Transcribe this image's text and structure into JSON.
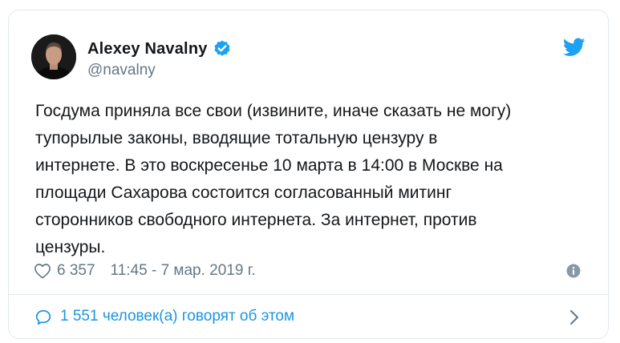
{
  "author": {
    "name": "Alexey Navalny",
    "handle": "@navalny"
  },
  "tweet": {
    "text": "Госдума приняла все свои (извините, иначе сказать не могу)\nтупорылые законы, вводящие тотальную цензуру в\nинтернете. В это воскресенье 10 марта в 14:00 в Москве на\nплощади Сахарова состоится согласованный митинг\nсторонников свободного интернета. За интернет, против\nцензуры.",
    "likes": "6 357",
    "timestamp": "11:45 - 7 мар. 2019 г."
  },
  "footer": {
    "conversation_label": "1 551 человек(а) говорят об этом"
  },
  "icons": {
    "verified": "verified-badge-icon",
    "brand": "twitter-bird-icon",
    "like": "heart-icon",
    "info": "info-icon",
    "reply": "speech-bubble-icon",
    "more": "chevron-right-icon"
  },
  "colors": {
    "accent": "#1da1f2",
    "link": "#1b95e0",
    "text": "#14171a",
    "secondary": "#657786",
    "border": "#e1e8ed"
  }
}
